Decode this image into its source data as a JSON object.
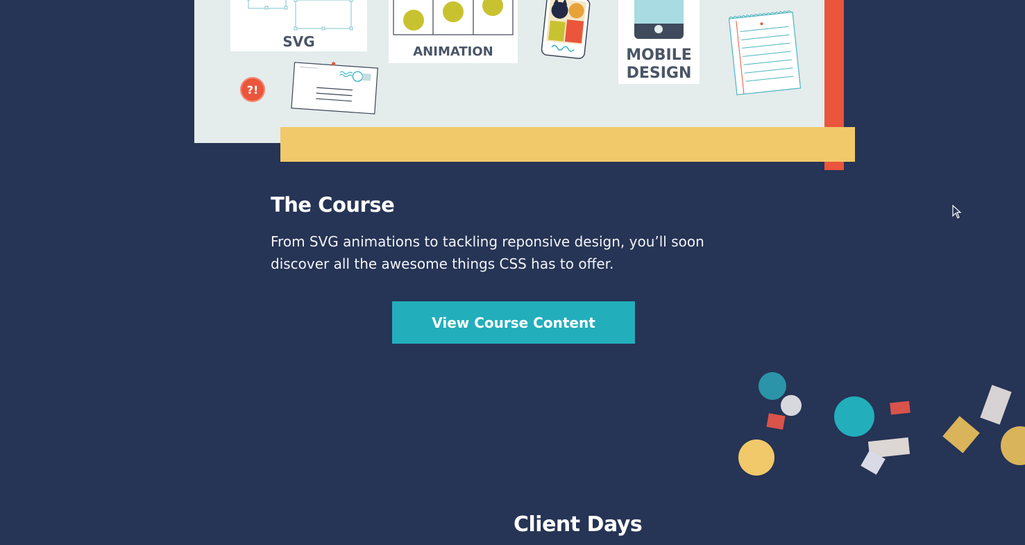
{
  "illustration": {
    "svg_label": "SVG",
    "animation_label": "ANIMATION",
    "mobile_label_line1": "MOBILE",
    "mobile_label_line2": "DESIGN",
    "alert_badge": "?!"
  },
  "course": {
    "title": "The Course",
    "description": "From SVG animations to tackling reponsive design, you’ll soon discover all the awesome things CSS has to offer.",
    "cta_label": "View Course Content"
  },
  "client_days": {
    "title": "Client Days"
  },
  "colors": {
    "background": "#263455",
    "accent_teal": "#23aebc",
    "accent_red": "#ea553b",
    "accent_yellow": "#f1c96a",
    "panel": "#e4ecec"
  },
  "icons": [
    "svg-card-icon",
    "animation-card-icon",
    "phone-pets-icon",
    "mobile-design-icon",
    "notepad-icon",
    "alert-badge-icon",
    "postcard-icon",
    "cursor-icon"
  ]
}
